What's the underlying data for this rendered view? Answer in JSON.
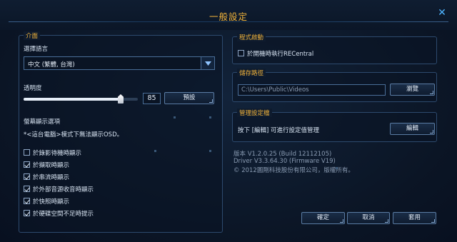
{
  "window": {
    "title": "一般設定",
    "close_icon": "close-icon"
  },
  "interface": {
    "section_title": "介面",
    "language_label": "選擇語言",
    "language_value": "中文 (繁體, 台灣)",
    "transparency_label": "透明度",
    "transparency_value": "85",
    "transparency_fraction": 0.85,
    "default_button": "預設",
    "osd_label": "螢幕顯示選項",
    "osd_note": "*<這台電腦>模式下無法顯示OSD。",
    "options": [
      {
        "label": "於錄影待機時顯示",
        "checked": false
      },
      {
        "label": "於擷取時顯示",
        "checked": true
      },
      {
        "label": "於串流時顯示",
        "checked": true
      },
      {
        "label": "於外部音源收音時顯示",
        "checked": true
      },
      {
        "label": "於快照時顯示",
        "checked": true
      },
      {
        "label": "於硬碟空間不足時提示",
        "checked": true
      }
    ]
  },
  "startup": {
    "section_title": "程式啟動",
    "run_on_boot_label": "於開機時執行RECentral",
    "run_on_boot_checked": false
  },
  "storage": {
    "section_title": "儲存路徑",
    "path": "C:\\Users\\Public\\Videos",
    "browse_button": "瀏覽"
  },
  "profiles": {
    "section_title": "管理設定檔",
    "hint": "按下 [編輯] 可進行設定值管理",
    "edit_button": "編輯"
  },
  "about": {
    "version": "版本 V1.2.0.25 (Build 12112105)",
    "driver": "Driver V3.3.64.30 (Firmware V19)",
    "copyright": "© 2012圓剛科技股份有限公司，版權所有。"
  },
  "footer": {
    "ok": "確定",
    "cancel": "取消",
    "apply": "套用"
  },
  "colors": {
    "accent": "#f0b23a",
    "border": "#2d4a6e",
    "background": "#0c1626"
  }
}
